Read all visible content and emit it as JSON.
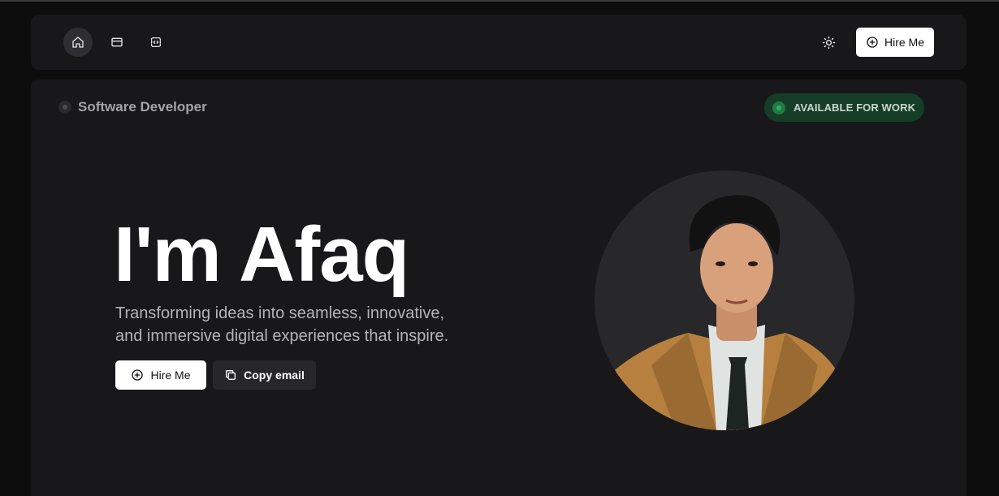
{
  "nav": {
    "icons": [
      "home-icon",
      "card-icon",
      "code-icon"
    ],
    "theme_icon": "sun-icon",
    "hire_label": "Hire Me"
  },
  "hero": {
    "role": "Software Developer",
    "status": "AVAILABLE FOR WORK",
    "title": "I'm Afaq",
    "subtitle": "Transforming ideas into seamless, innovative, and immersive digital experiences that inspire.",
    "hire_label": "Hire Me",
    "copy_label": "Copy email"
  },
  "colors": {
    "background": "#0d0d0e",
    "panel": "#18181b",
    "status_bg": "#163d28",
    "status_dot": "#2fae62"
  }
}
